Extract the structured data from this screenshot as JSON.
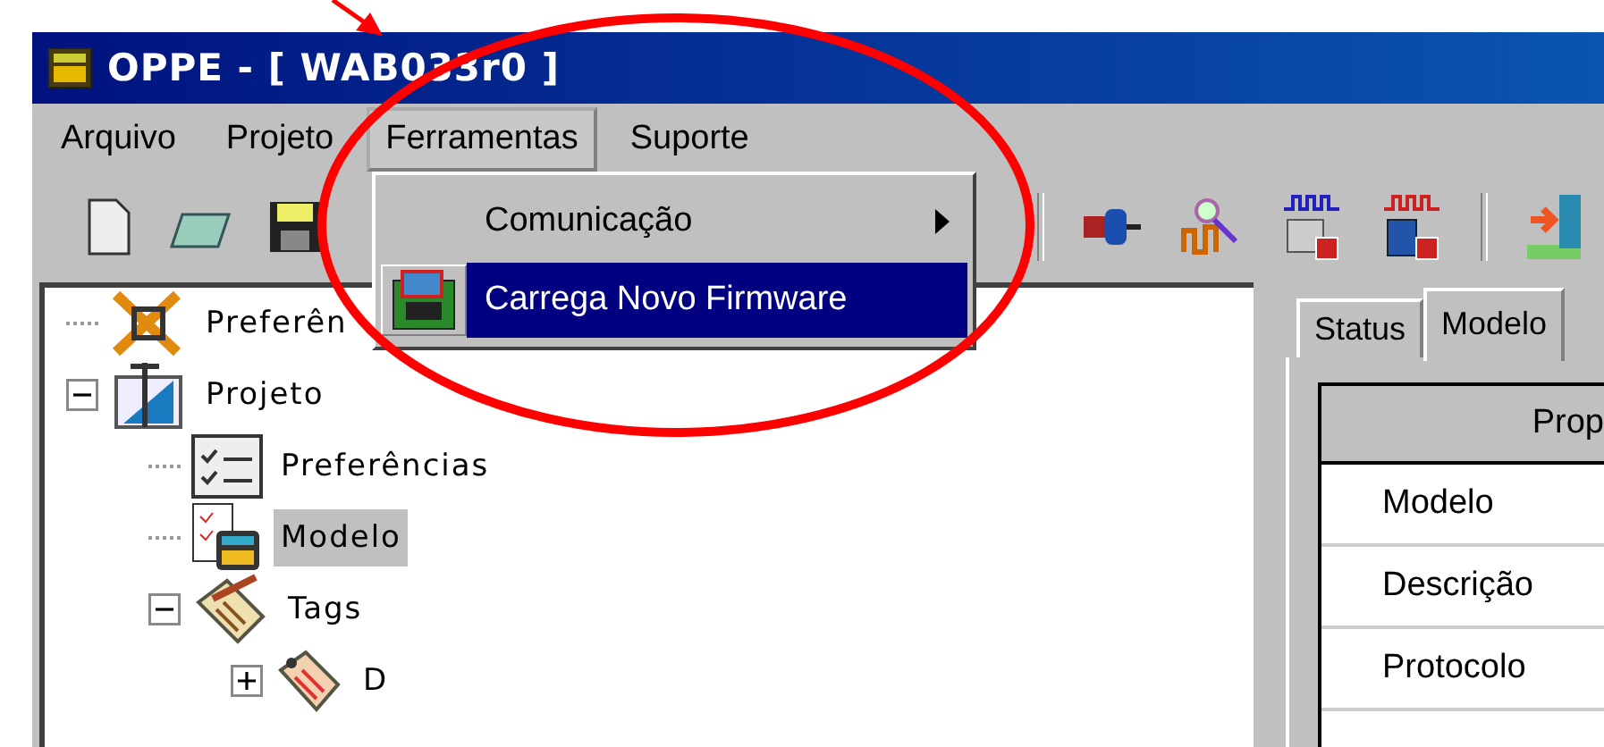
{
  "window": {
    "title": "OPPE - [ WAB033r0 ]"
  },
  "menu": [
    {
      "label": "Arquivo",
      "selected": false
    },
    {
      "label": "Projeto",
      "selected": false
    },
    {
      "label": "Ferramentas",
      "selected": true
    },
    {
      "label": "Suporte",
      "selected": false
    }
  ],
  "toolbar": [
    {
      "kind": "new"
    },
    {
      "kind": "open"
    },
    {
      "kind": "save"
    },
    {
      "kind": "gap"
    },
    {
      "kind": "sep"
    },
    {
      "kind": "connect"
    },
    {
      "kind": "inspect"
    },
    {
      "kind": "wave-blue"
    },
    {
      "kind": "wave-red"
    },
    {
      "kind": "sep"
    },
    {
      "kind": "exit"
    }
  ],
  "dropdown": [
    {
      "label": "Comunicação",
      "submenu": true,
      "kind": "plain",
      "selected": false
    },
    {
      "label": "Carrega Novo Firmware",
      "submenu": false,
      "kind": "chip",
      "selected": true
    }
  ],
  "tree": [
    {
      "label": "Preferên",
      "kind": "tools",
      "selected": false
    },
    {
      "label": "Projeto",
      "kind": "project",
      "selected": false,
      "expanded": true,
      "children": [
        {
          "label": "Preferências",
          "kind": "checklist",
          "selected": false
        },
        {
          "label": "Modelo",
          "kind": "model",
          "selected": true
        },
        {
          "label": "Tags",
          "kind": "tags",
          "selected": false,
          "expanded": true,
          "children": [
            {
              "label": "D",
              "kind": "tag",
              "selected": false,
              "expanded": false
            }
          ]
        }
      ]
    }
  ],
  "tabs": [
    {
      "label": "Status",
      "selected": false
    },
    {
      "label": "Modelo",
      "selected": true
    }
  ],
  "properties": {
    "columns": [
      "Prop"
    ],
    "rows": [
      "Modelo",
      "Descrição",
      "Protocolo"
    ]
  },
  "annotation": {
    "kind": "ellipse-arrow"
  }
}
